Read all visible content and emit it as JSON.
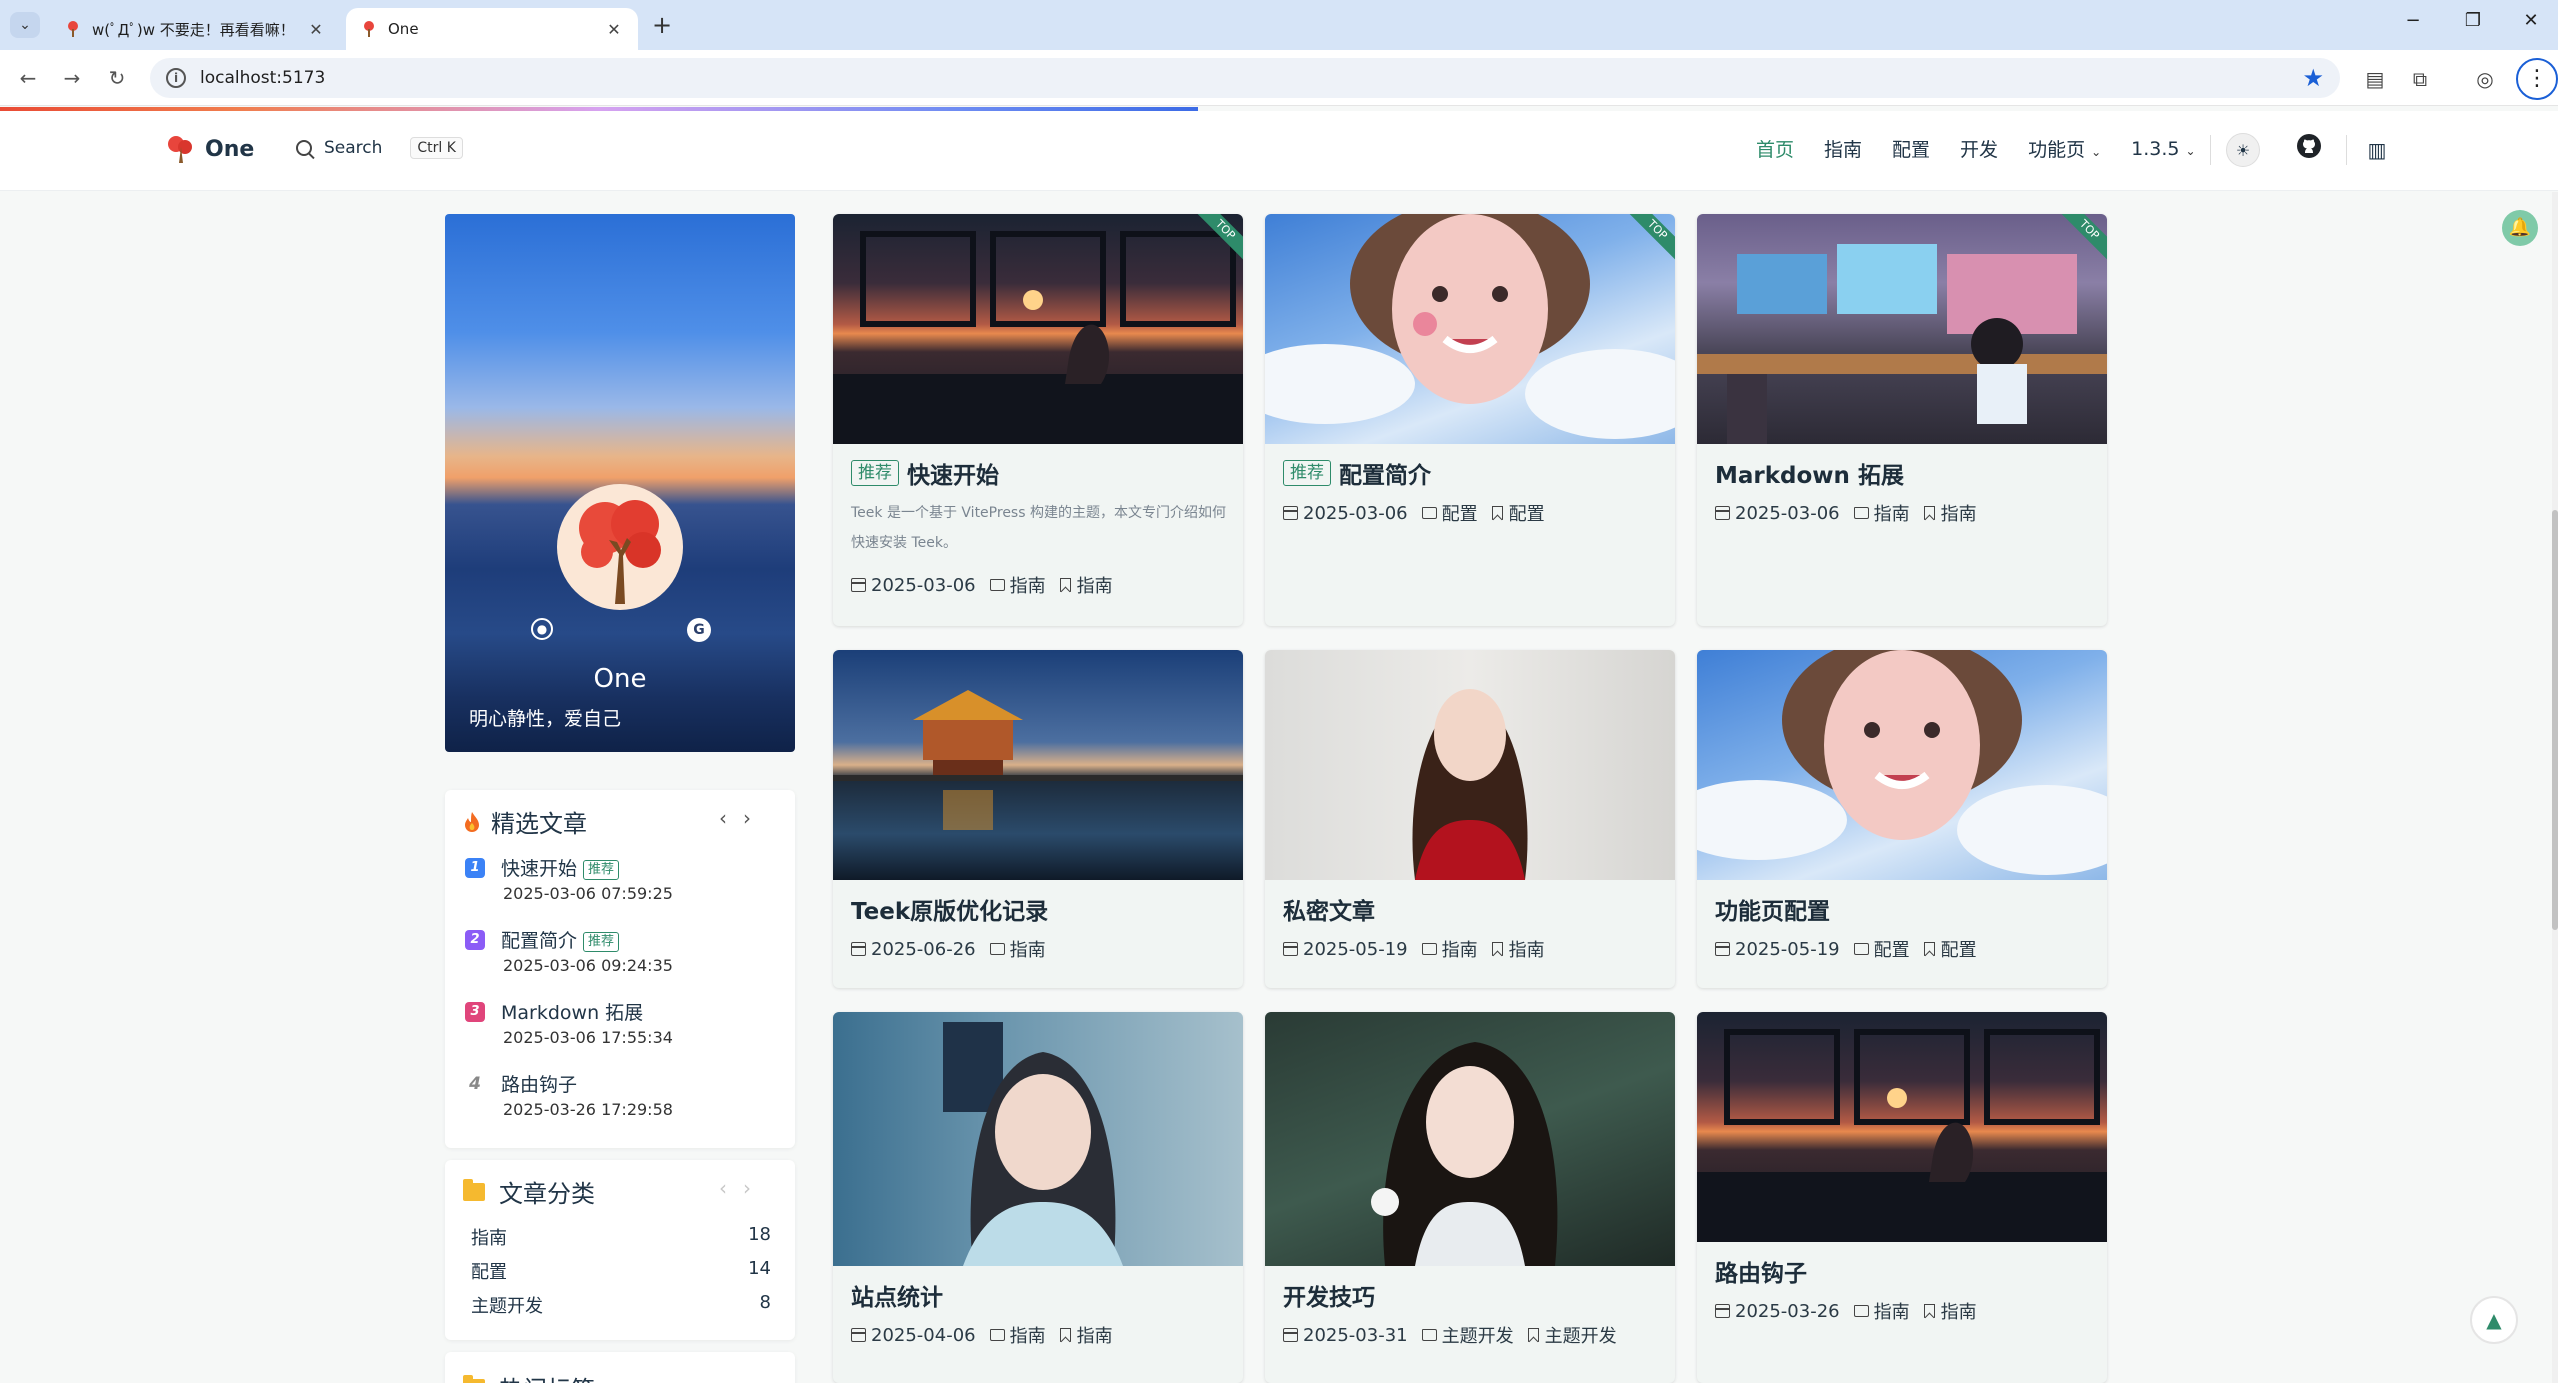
{
  "browser": {
    "tabs": [
      {
        "title": "w(ﾟДﾟ)w 不要走！再看看嘛！"
      },
      {
        "title": "One"
      }
    ],
    "url": "localhost:5173"
  },
  "site": {
    "logo_text": "One",
    "search_label": "Search",
    "search_shortcut": "Ctrl K",
    "nav": [
      "首页",
      "指南",
      "配置",
      "开发",
      "功能页",
      "1.3.5"
    ],
    "active_nav": "首页"
  },
  "profile": {
    "name": "One",
    "motto": "明心静性，爱自己"
  },
  "featured": {
    "title": "精选文章",
    "items": [
      {
        "rank": "1",
        "title": "快速开始",
        "badge": "推荐",
        "date": "2025-03-06 07:59:25",
        "color": "#3b82f6"
      },
      {
        "rank": "2",
        "title": "配置简介",
        "badge": "推荐",
        "date": "2025-03-06 09:24:35",
        "color": "#8b5cf6"
      },
      {
        "rank": "3",
        "title": "Markdown 拓展",
        "badge": "",
        "date": "2025-03-06 17:55:34",
        "color": "#e0457b"
      },
      {
        "rank": "4",
        "title": "路由钩子",
        "badge": "",
        "date": "2025-03-26 17:29:58",
        "color": ""
      }
    ]
  },
  "categories": {
    "title": "文章分类",
    "items": [
      {
        "name": "指南",
        "count": "18"
      },
      {
        "name": "配置",
        "count": "14"
      },
      {
        "name": "主题开发",
        "count": "8"
      }
    ]
  },
  "tags_panel": {
    "title": "热门标签"
  },
  "posts": [
    {
      "title": "快速开始",
      "badge": "推荐",
      "top": "TOP",
      "desc": "Teek 是一个基于 VitePress 构建的主题，本文专门介绍如何快速安装 Teek。",
      "date": "2025-03-06",
      "category": "指南",
      "tag": "指南"
    },
    {
      "title": "配置简介",
      "badge": "推荐",
      "top": "TOP",
      "desc": "",
      "date": "2025-03-06",
      "category": "配置",
      "tag": "配置"
    },
    {
      "title": "Markdown 拓展",
      "badge": "",
      "top": "TOP",
      "desc": "",
      "date": "2025-03-06",
      "category": "指南",
      "tag": "指南"
    },
    {
      "title": "Teek原版优化记录",
      "badge": "",
      "top": "",
      "desc": "",
      "date": "2025-06-26",
      "category": "指南",
      "tag": ""
    },
    {
      "title": "私密文章",
      "badge": "",
      "top": "",
      "desc": "",
      "date": "2025-05-19",
      "category": "指南",
      "tag": "指南"
    },
    {
      "title": "功能页配置",
      "badge": "",
      "top": "",
      "desc": "",
      "date": "2025-05-19",
      "category": "配置",
      "tag": "配置"
    },
    {
      "title": "站点统计",
      "badge": "",
      "top": "",
      "desc": "",
      "date": "2025-04-06",
      "category": "指南",
      "tag": "指南"
    },
    {
      "title": "开发技巧",
      "badge": "",
      "top": "",
      "desc": "",
      "date": "2025-03-31",
      "category": "主题开发",
      "tag": "主题开发"
    },
    {
      "title": "路由钩子",
      "badge": "",
      "top": "",
      "desc": "",
      "date": "2025-03-26",
      "category": "指南",
      "tag": "指南"
    }
  ],
  "colors": {
    "brand": "#2e8b6a",
    "progress_start": "#e94b35",
    "progress_end": "#3c6be6"
  }
}
